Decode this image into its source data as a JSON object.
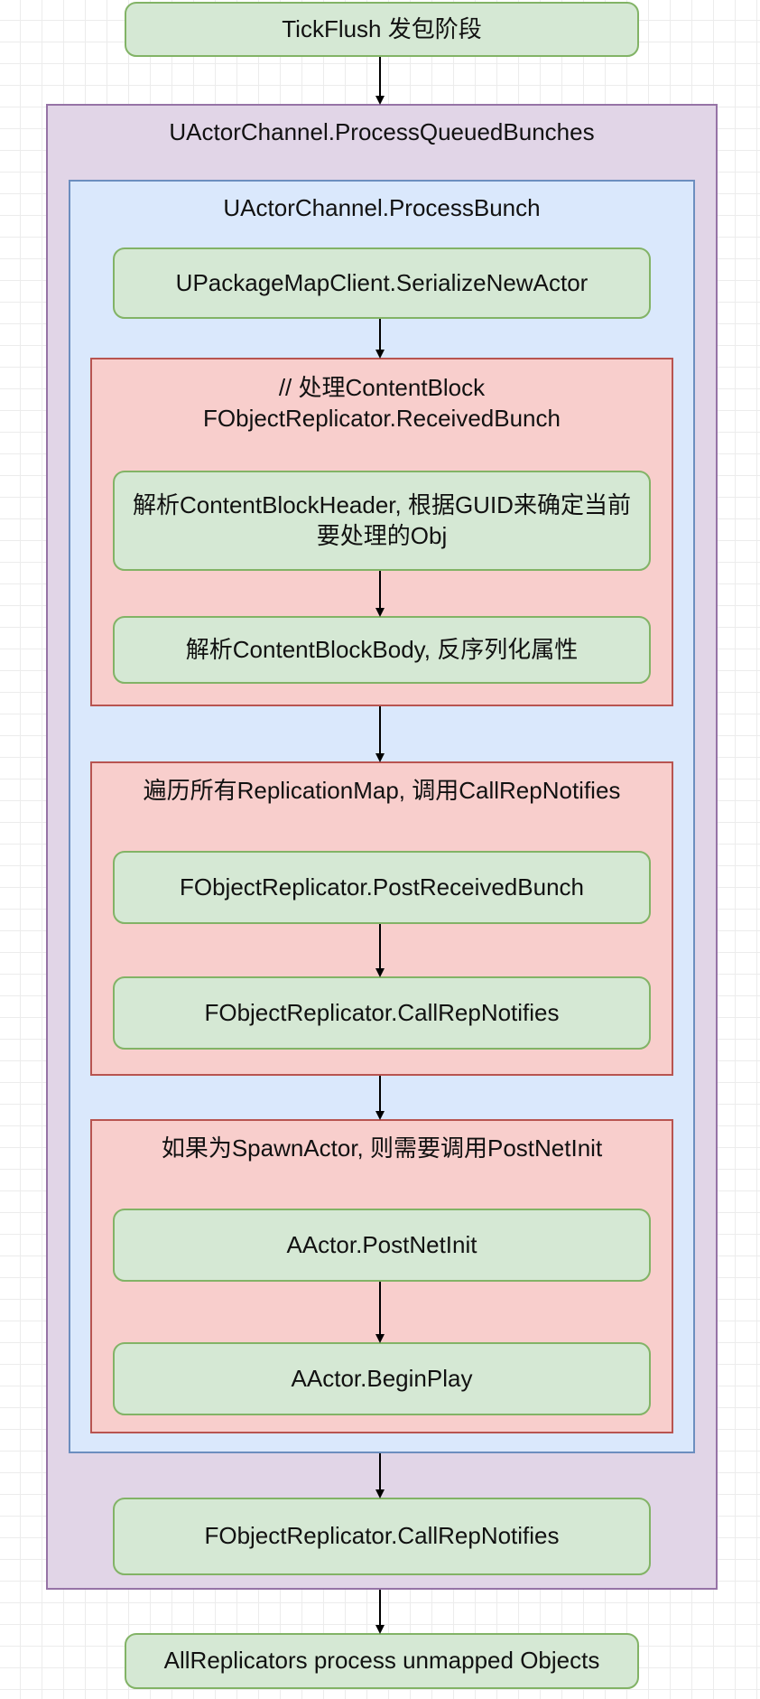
{
  "nodes": {
    "tickflush": "TickFlush 发包阶段",
    "serialize_new_actor": "UPackageMapClient.SerializeNewActor",
    "parse_header": "解析ContentBlockHeader, 根据GUID来确定当前要处理的Obj",
    "parse_body": "解析ContentBlockBody, 反序列化属性",
    "post_received_bunch": "FObjectReplicator.PostReceivedBunch",
    "call_rep_notifies_inner": "FObjectReplicator.CallRepNotifies",
    "post_net_init": "AActor.PostNetInit",
    "begin_play": "AActor.BeginPlay",
    "call_rep_notifies_outer": "FObjectReplicator.CallRepNotifies",
    "unmapped_objects": "AllReplicators process unmapped Objects"
  },
  "containers": {
    "process_queued_bunches": "UActorChannel.ProcessQueuedBunches",
    "process_bunch": "UActorChannel.ProcessBunch",
    "received_bunch": "// 处理ContentBlock\nFObjectReplicator.ReceivedBunch",
    "replication_map": "遍历所有ReplicationMap, 调用CallRepNotifies",
    "spawn_actor": "如果为SpawnActor, 则需要调用PostNetInit"
  },
  "colors": {
    "node_fill": "#d5e8d4",
    "node_stroke": "#82b366",
    "purple_fill": "#e1d5e7",
    "purple_stroke": "#9673a6",
    "blue_fill": "#dae8fc",
    "blue_stroke": "#6c8ebf",
    "red_fill": "#f8cecc",
    "red_stroke": "#b85450",
    "arrow": "#000000"
  }
}
